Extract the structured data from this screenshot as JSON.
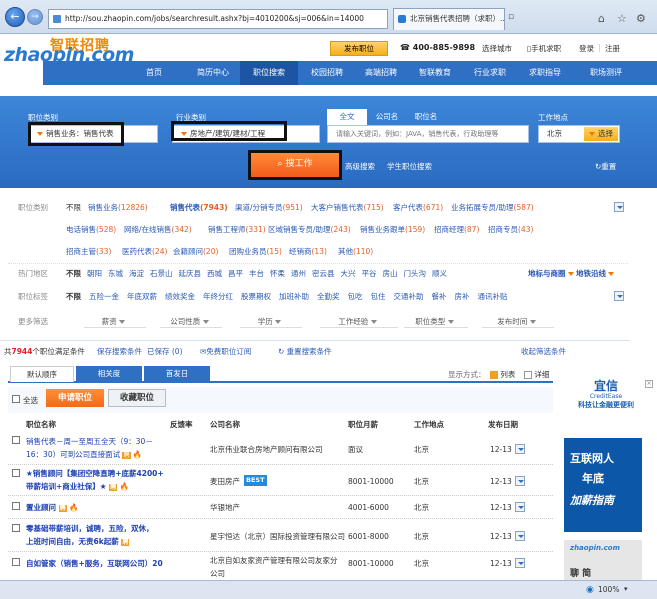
{
  "browser": {
    "url": "http://sou.zhaopin.com/jobs/searchresult.ashx?bj=4010200&sj=006&in=14000",
    "tab_title": "北京销售代表招聘（求职）...",
    "zoom": "100%"
  },
  "header": {
    "logo_cn": "智联招聘",
    "logo_en": "zhaopin.com",
    "post_job": "发布职位",
    "phone": "400-885-9898",
    "choose_city": "选择城市",
    "mobile_jobs": "手机求职",
    "login": "登录",
    "register": "注册"
  },
  "nav": [
    "首页",
    "简历中心",
    "职位搜索",
    "校园招聘",
    "高端招聘",
    "智联教育",
    "行业求职",
    "求职指导",
    "职场测评"
  ],
  "search": {
    "category_label": "职位类别",
    "category_value": "销售业务：销售代表",
    "industry_label": "行业类别",
    "industry_value": "房地产/建筑/建材/工程",
    "tabs": [
      "全文",
      "公司名",
      "职位名"
    ],
    "keyword_placeholder": "请输入关键词，例如：JAVA，销售代表，行政助理等",
    "location_label": "工作地点",
    "location_value": "北京",
    "select_btn": "选择",
    "go_btn": "搜工作",
    "advanced": "高级搜索",
    "student": "学生职位搜索",
    "reset": "重置"
  },
  "filters": {
    "category_label": "职位类别",
    "category_row1": [
      {
        "t": "不限",
        "c": ""
      },
      {
        "t": "销售业务",
        "c": "(12826)"
      },
      {
        "t": "销售代表",
        "c": "(7943)"
      },
      {
        "t": "渠道/分销专员",
        "c": "(951)"
      },
      {
        "t": "大客户销售代表",
        "c": "(715)"
      },
      {
        "t": "客户代表",
        "c": "(671)"
      },
      {
        "t": "业务拓展专员/助理",
        "c": "(587)"
      }
    ],
    "category_row2": [
      {
        "t": "电话销售",
        "c": "(528)"
      },
      {
        "t": "网络/在线销售",
        "c": "(342)"
      },
      {
        "t": "销售工程师",
        "c": "(331)"
      },
      {
        "t": "区域销售专员/助理",
        "c": "(243)"
      },
      {
        "t": "销售业务跟单",
        "c": "(159)"
      },
      {
        "t": "招商经理",
        "c": "(87)"
      },
      {
        "t": "招商专员",
        "c": "(43)"
      }
    ],
    "category_row3": [
      {
        "t": "招商主管",
        "c": "(33)"
      },
      {
        "t": "医药代表",
        "c": "(24)"
      },
      {
        "t": "会籍顾问",
        "c": "(20)"
      },
      {
        "t": "团购业务员",
        "c": "(15)"
      },
      {
        "t": "经销商",
        "c": "(13)"
      },
      {
        "t": "其他",
        "c": "(110)"
      }
    ],
    "hot_label": "热门地区",
    "hot_areas": [
      "不限",
      "朝阳",
      "东城",
      "海淀",
      "石景山",
      "延庆县",
      "西城",
      "昌平",
      "丰台",
      "怀柔",
      "通州",
      "密云县",
      "大兴",
      "平谷",
      "房山",
      "门头沟",
      "顺义"
    ],
    "metro": "地标与商圈",
    "subway": "地铁沿线",
    "benefit_label": "职位标签",
    "benefits": [
      "不限",
      "五险一金",
      "年底双薪",
      "绩效奖金",
      "年终分红",
      "股票期权",
      "加班补助",
      "全勤奖",
      "包吃",
      "包住",
      "交通补助",
      "餐补",
      "房补",
      "通讯补贴"
    ],
    "more_label": "更多筛选",
    "selects": [
      "薪资",
      "公司性质",
      "学历",
      "工作经验",
      "职位类型",
      "发布时间"
    ]
  },
  "summary": {
    "count_prefix": "共",
    "count": "7944",
    "count_suffix": "个职位满足条件",
    "save_search": "保存搜索条件",
    "saved": "已保存 (0)",
    "subscribe": "免费职位订阅",
    "reset_search": "重置搜索条件",
    "collapse": "收起筛选条件"
  },
  "result_tabs": [
    "默认顺序",
    "相关度",
    "首发日"
  ],
  "display_mode": "显示方式：",
  "list_view": "列表",
  "detail_view": "详细",
  "actions": {
    "select_all": "全选",
    "apply": "申请职位",
    "favorite": "收藏职位"
  },
  "columns": [
    "职位名称",
    "反馈率",
    "公司名称",
    "职位月薪",
    "工作地点",
    "发布日期"
  ],
  "jobs": [
    {
      "title1": "销售代表－周一至周五全天（9：30－",
      "title2": "16：30）可到公司直接面试",
      "company": "北京伟业联合房地产顾问有限公司",
      "salary": "面议",
      "location": "北京",
      "date": "12-13"
    },
    {
      "title1": "★销售顾问【集团空降直聘+底薪4200+",
      "title2": "带薪培训+商业社保】★",
      "company": "麦田房产",
      "company_badge": "BEST",
      "salary": "8001-10000",
      "location": "北京",
      "date": "12-13"
    },
    {
      "title1": "置业顾问",
      "title2": "",
      "company": "华银地产",
      "salary": "4001-6000",
      "location": "北京",
      "date": "12-13"
    },
    {
      "title1": "零基础带薪培训，诚聘，五险，双休，",
      "title2": "上班时间自由，无责6k起薪",
      "company": "星宇恒达（北京）国际投资管理有限公司",
      "salary": "6001-8000",
      "location": "北京",
      "date": "12-13"
    },
    {
      "title1": "自如管家（销售+服务，互联网公司）20",
      "title2": "",
      "company": "北京自如友家资产管理有限公司友家分",
      "company2": "公司",
      "salary": "8001-10000",
      "location": "北京",
      "date": "12-13"
    }
  ],
  "ads": {
    "ad1_title": "宜信",
    "ad1_en": "CreditEase",
    "ad1_sub": "科技让金融更便利",
    "ad2_l1": "互联网人",
    "ad2_l2": "年底",
    "ad2_l3": "加薪指南",
    "ad3_text": "zhaopin.com",
    "ad3_sub": "聊 简"
  }
}
